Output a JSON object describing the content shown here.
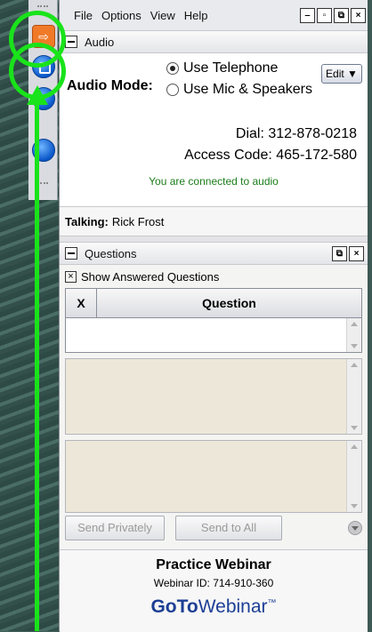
{
  "menu": {
    "items": [
      "File",
      "Options",
      "View",
      "Help"
    ]
  },
  "window_buttons": [
    "minimize",
    "restore",
    "popout",
    "close"
  ],
  "audio": {
    "section_title": "Audio",
    "mode_label": "Audio Mode:",
    "options": [
      "Use Telephone",
      "Use Mic & Speakers"
    ],
    "selected_option": "Use Telephone",
    "edit_label": "Edit ▼",
    "dial_label": "Dial:",
    "dial_number": "312-878-0218",
    "access_label": "Access Code:",
    "access_code": "465-172-580",
    "status": "You are connected to audio"
  },
  "talking": {
    "label": "Talking:",
    "name": "Rick Frost"
  },
  "questions": {
    "section_title": "Questions",
    "show_answered": "Show Answered Questions",
    "col_x": "X",
    "col_question": "Question",
    "send_privately": "Send Privately",
    "send_to_all": "Send to All"
  },
  "footer": {
    "title": "Practice Webinar",
    "webinar_id": "Webinar ID: 714-910-360",
    "logo_goto": "GoTo",
    "logo_webinar": "Webinar",
    "logo_tm": "™"
  },
  "colors": {
    "annotation": "#19e31a",
    "dock_tab_orange": "#f07a28",
    "dock_tab_blue": "#0a57c9"
  }
}
